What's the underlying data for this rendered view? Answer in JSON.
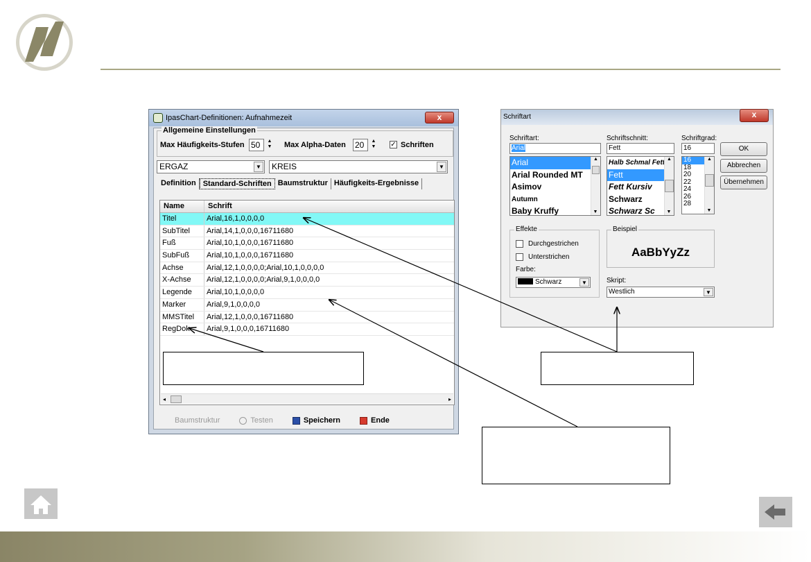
{
  "slide": {
    "logo": "ipas-logo-icon",
    "nav": {
      "home": "home-icon",
      "back": "back-arrow-icon"
    }
  },
  "dialog1": {
    "title": "IpasChart-Definitionen: Aufnahmezeit",
    "close": "x",
    "group_title": "Allgemeine Einstellungen",
    "max_stufen_label": "Max Häufigkeits-Stufen",
    "max_stufen_value": "50",
    "max_alpha_label": "Max Alpha-Daten",
    "max_alpha_value": "20",
    "schriften_label": "Schriften",
    "schriften_checked": "✓",
    "combo1_value": "ERGAZ",
    "combo2_value": "KREIS",
    "tabs": [
      "Definition",
      "Standard-Schriften",
      "Baumstruktur",
      "Häufigkeits-Ergebnisse"
    ],
    "table": {
      "headers": [
        "Name",
        "Schrift"
      ],
      "rows": [
        [
          "Titel",
          "Arial,16,1,0,0,0,0"
        ],
        [
          "SubTitel",
          "Arial,14,1,0,0,0,16711680"
        ],
        [
          "Fuß",
          "Arial,10,1,0,0,0,16711680"
        ],
        [
          "SubFuß",
          "Arial,10,1,0,0,0,16711680"
        ],
        [
          "Achse",
          "Arial,12,1,0,0,0,0;Arial,10,1,0,0,0,0"
        ],
        [
          "X-Achse",
          "Arial,12,1,0,0,0,0;Arial,9,1,0,0,0,0"
        ],
        [
          "Legende",
          "Arial,10,1,0,0,0,0"
        ],
        [
          "Marker",
          "Arial,9,1,0,0,0,0"
        ],
        [
          "MMSTitel",
          "Arial,12,1,0,0,0,16711680"
        ],
        [
          "RegDok",
          "Arial,9,1,0,0,0,16711680"
        ]
      ]
    },
    "buttons": {
      "baumstruktur": "Baumstruktur",
      "testen": "Testen",
      "speichern": "Speichern",
      "ende": "Ende"
    }
  },
  "dialog2": {
    "title": "Schriftart",
    "close": "x",
    "schriftart_label": "Schriftart:",
    "schriftart_value": "Arial",
    "schriftart_list": [
      "Arial",
      "Arial Rounded MT",
      "Asimov",
      "Autumn",
      "Baby Kruffy"
    ],
    "schriftschnitt_label": "Schriftschnitt:",
    "schriftschnitt_value": "Fett",
    "schriftschnitt_list": [
      "Halb Schmal Fett",
      "Fett",
      "Fett Kursiv",
      "Schwarz",
      "Schwarz Sc"
    ],
    "schriftgrad_label": "Schriftgrad:",
    "schriftgrad_value": "16",
    "schriftgrad_list": [
      "16",
      "18",
      "20",
      "22",
      "24",
      "26",
      "28"
    ],
    "ok": "OK",
    "abbrechen": "Abbrechen",
    "uebernehmen": "Übernehmen",
    "effekte_label": "Effekte",
    "durchgestrichen": "Durchgestrichen",
    "unterstrichen": "Unterstrichen",
    "farbe_label": "Farbe:",
    "farbe_value": "Schwarz",
    "beispiel_label": "Beispiel",
    "beispiel_text": "AaBbYyZz",
    "skript_label": "Skript:",
    "skript_value": "Westlich"
  },
  "colors": {
    "selected_row": "#82f8f6",
    "list_selection": "#3399ff",
    "divider": "#a9a784",
    "nav_button": "#c7c7c7"
  }
}
